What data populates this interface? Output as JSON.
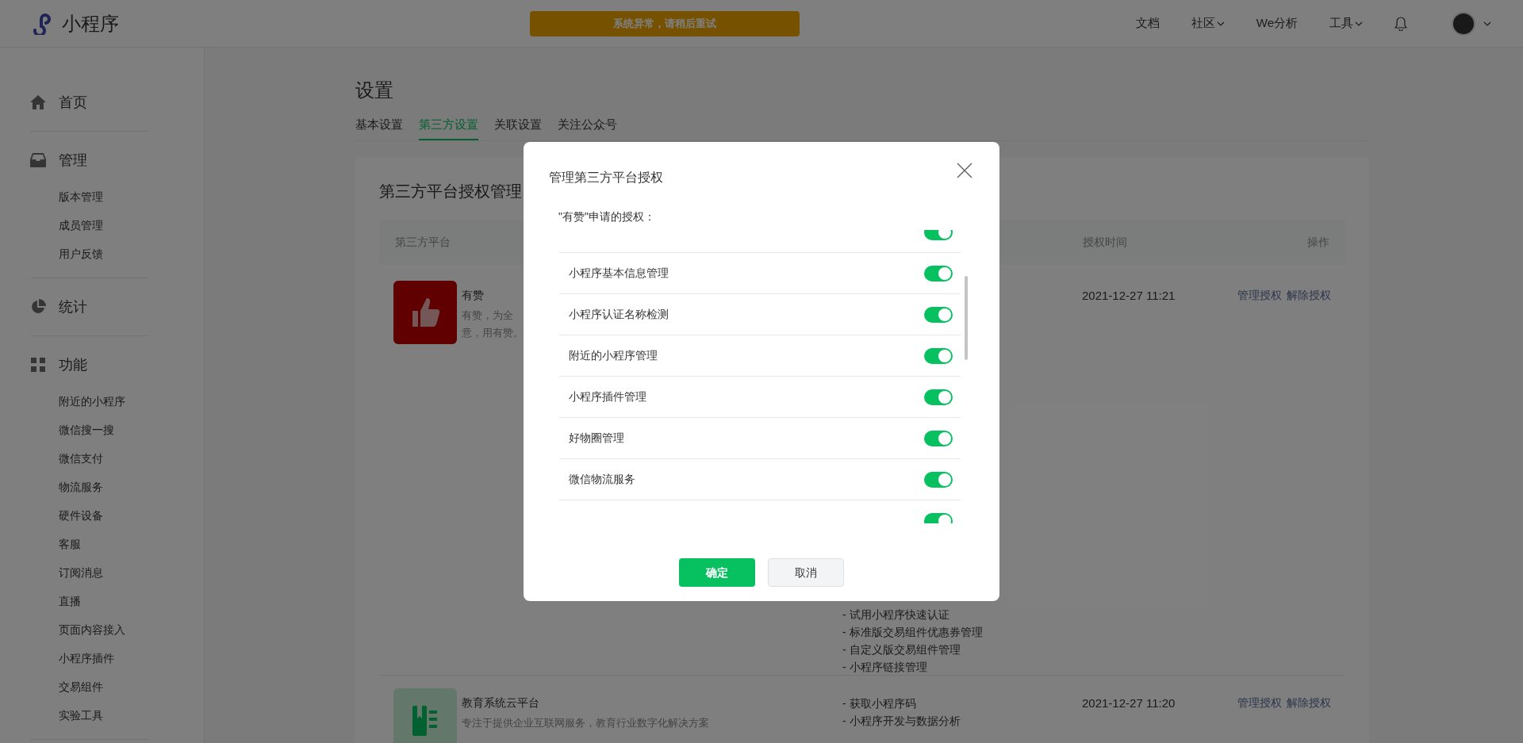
{
  "header": {
    "logo_text": "小程序",
    "alert": "系统异常，请稍后重试",
    "nav": [
      {
        "label": "文档",
        "dropdown": false
      },
      {
        "label": "社区",
        "dropdown": true
      },
      {
        "label": "We分析",
        "dropdown": false
      },
      {
        "label": "工具",
        "dropdown": true
      }
    ]
  },
  "sidebar": {
    "sections": [
      {
        "kind": "home",
        "label": "首页"
      },
      {
        "kind": "inbox",
        "label": "管理",
        "children": [
          "版本管理",
          "成员管理",
          "用户反馈"
        ]
      },
      {
        "kind": "chart",
        "label": "统计"
      },
      {
        "kind": "grid",
        "label": "功能",
        "children": [
          "附近的小程序",
          "微信搜一搜",
          "微信支付",
          "物流服务",
          "硬件设备",
          "客服",
          "订阅消息",
          "直播",
          "页面内容接入",
          "小程序插件",
          "交易组件",
          "实验工具"
        ]
      }
    ]
  },
  "page": {
    "title": "设置",
    "tabs": [
      {
        "label": "基本设置",
        "selected": false
      },
      {
        "label": "第三方设置",
        "selected": true
      },
      {
        "label": "关联设置",
        "selected": false
      },
      {
        "label": "关注公众号",
        "selected": false
      }
    ]
  },
  "card": {
    "title": "第三方平台授权管理",
    "table": {
      "column_1": "第三方平台",
      "column_time": "授权时间",
      "column_actions": "操作",
      "rows": [
        {
          "kind": "thumb",
          "name": "有赞",
          "description": [
            "有赞，为全",
            "意，用有赞。"
          ],
          "permissions": [
            "- 试用小程序快速认证",
            "- 标准版交易组件优惠券管理",
            "- 自定义版交易组件管理",
            "- 小程序链接管理"
          ],
          "time": "2021-12-27 11:21",
          "actions": [
            "管理授权",
            "解除授权"
          ]
        },
        {
          "kind": "book",
          "name": "教育系统云平台",
          "description": [
            "专注于提供企业互联网服务，教育行业数字化解决方案"
          ],
          "permissions": [
            "- 获取小程序码",
            "- 小程序开发与数据分析"
          ],
          "time": "2021-12-27 11:20",
          "actions": [
            "管理授权",
            "解除授权"
          ]
        }
      ]
    }
  },
  "modal": {
    "title": "管理第三方平台授权",
    "subtitle": "\"有赞\"申请的授权：",
    "items": [
      {
        "on": true
      },
      {
        "label": "小程序基本信息管理",
        "on": true
      },
      {
        "label": "小程序认证名称检测",
        "on": true
      },
      {
        "label": "附近的小程序管理",
        "on": true
      },
      {
        "label": "小程序插件管理",
        "on": true
      },
      {
        "label": "好物圈管理",
        "on": true
      },
      {
        "label": "微信物流服务",
        "on": true
      },
      {
        "on": true
      }
    ],
    "buttons": [
      {
        "label": "确定",
        "kind": "primary"
      },
      {
        "label": "取消",
        "kind": "secondary"
      }
    ]
  }
}
